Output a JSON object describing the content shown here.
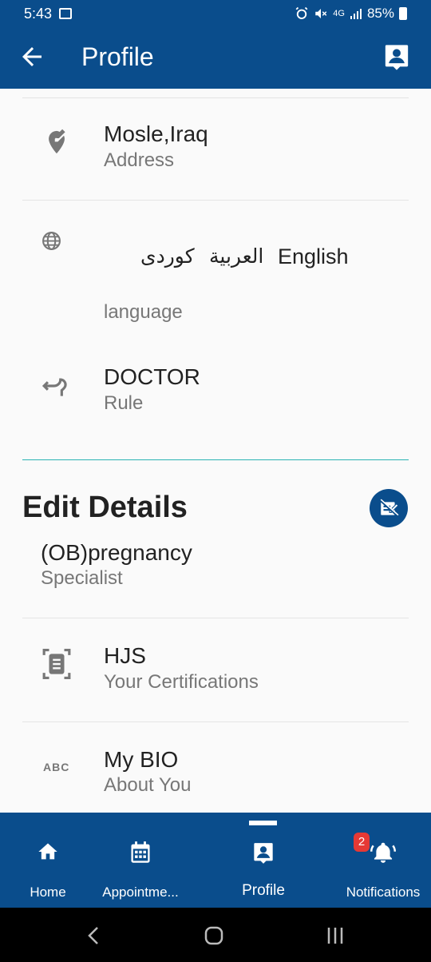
{
  "status_bar": {
    "time": "5:43",
    "network": "4G",
    "battery": "85%"
  },
  "app_bar": {
    "title": "Profile",
    "back_icon": "arrow-left-icon",
    "action_icon": "account-box-icon"
  },
  "address": {
    "value": "Mosle,Iraq",
    "label": "Address",
    "icon": "edit-location-icon"
  },
  "language": {
    "icon": "globe-icon",
    "options": [
      "كوردى",
      "العربية",
      "English"
    ],
    "label": "language"
  },
  "role": {
    "value": "DOCTOR",
    "label": "Rule",
    "icon": "u-turn-left-icon"
  },
  "edit_details": {
    "title": "Edit Details",
    "button_icon": "edit-document-icon"
  },
  "specialist": {
    "value": "(OB)pregnancy",
    "label": "Specialist"
  },
  "certifications": {
    "value": "HJS",
    "label": "Your Certifications",
    "icon": "document-scanner-icon"
  },
  "bio": {
    "value": "My BIO",
    "label": "About You",
    "icon_text": "ABC"
  },
  "bottom_nav": {
    "items": [
      {
        "label": "Home",
        "icon": "home-icon"
      },
      {
        "label": "Appointme...",
        "icon": "calendar-icon"
      },
      {
        "label": "Profile",
        "icon": "account-box-icon"
      },
      {
        "label": "Notifications",
        "icon": "bell-icon"
      }
    ],
    "active": "Profile",
    "notification_count": "2"
  },
  "colors": {
    "primary": "#0a4d8c",
    "accent_divider": "#2bb3b3",
    "badge": "#e53935"
  }
}
